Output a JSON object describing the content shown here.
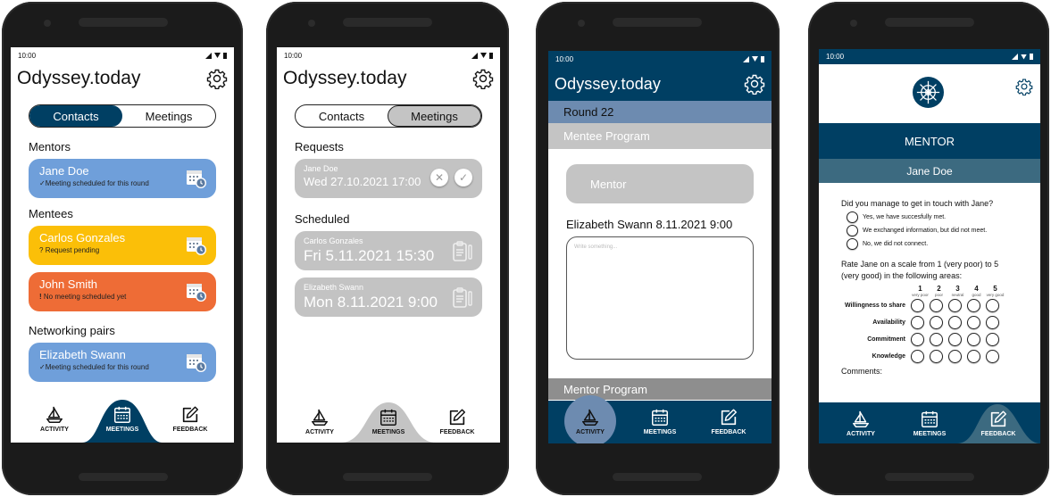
{
  "colors": {
    "primary": "#003f63",
    "blue_card": "#6f9fda",
    "yellow_card": "#fbbf08",
    "orange_card": "#ee6c36",
    "gray_card": "#c3c3c3",
    "round_bar": "#6d8bb0",
    "program_bar_light": "#c4c4c4",
    "program_bar_dark": "#8e8e8e",
    "mentor_sub_bar": "#3c6a80"
  },
  "status_time": "10:00",
  "app_title": "Odyssey.today",
  "nav": {
    "activity": "ACTIVITY",
    "meetings": "MEETINGS",
    "feedback": "FEEDBACK"
  },
  "screen1": {
    "tabs": {
      "contacts": "Contacts",
      "meetings": "Meetings"
    },
    "sections": [
      {
        "title": "Mentors",
        "items": [
          {
            "name": "Jane Doe",
            "status_glyph": "✓",
            "status": "Meeting scheduled for this round",
            "color": "blue"
          }
        ]
      },
      {
        "title": "Mentees",
        "items": [
          {
            "name": "Carlos Gonzales",
            "status_glyph": "?",
            "status": "Request pending",
            "color": "yellow"
          },
          {
            "name": "John Smith",
            "status_glyph": "!",
            "status": "No meeting scheduled yet",
            "color": "orange"
          }
        ]
      },
      {
        "title": "Networking pairs",
        "items": [
          {
            "name": "Elizabeth Swann",
            "status_glyph": "✓",
            "status": "Meeting scheduled for this round",
            "color": "blue"
          }
        ]
      }
    ]
  },
  "screen2": {
    "tabs": {
      "contacts": "Contacts",
      "meetings": "Meetings"
    },
    "requests_title": "Requests",
    "requests": [
      {
        "name": "Jane Doe",
        "datetime": "Wed 27.10.2021 17:00",
        "decline": "✕",
        "accept": "✓"
      }
    ],
    "scheduled_title": "Scheduled",
    "scheduled": [
      {
        "name": "Carlos Gonzales",
        "datetime": "Fri 5.11.2021 15:30"
      },
      {
        "name": "Elizabeth Swann",
        "datetime": "Mon 8.11.2021 9:00"
      }
    ]
  },
  "screen3": {
    "round": "Round 22",
    "mentee_program": "Mentee Program",
    "mentor_button": "Mentor",
    "notes_title": "Elizabeth Swann 8.11.2021 9:00",
    "notes_placeholder": "Write something...",
    "mentor_program": "Mentor Program"
  },
  "screen4": {
    "role": "MENTOR",
    "person": "Jane Doe",
    "question1": "Did you manage to get in touch with Jane?",
    "options": [
      "Yes, we have succesfully met.",
      "We exchanged information, but did not meet.",
      "No, we did not connect."
    ],
    "question2": "Rate Jane on a scale from 1 (very poor) to 5 (very good) in the following areas:",
    "scale": [
      {
        "value": "1",
        "label": "very poor"
      },
      {
        "value": "2",
        "label": "poor"
      },
      {
        "value": "3",
        "label": "neutral"
      },
      {
        "value": "4",
        "label": "good"
      },
      {
        "value": "5",
        "label": "very good"
      }
    ],
    "criteria": [
      "Willingness to share",
      "Availability",
      "Commitment",
      "Knowledge"
    ],
    "comments_label": "Comments:"
  }
}
